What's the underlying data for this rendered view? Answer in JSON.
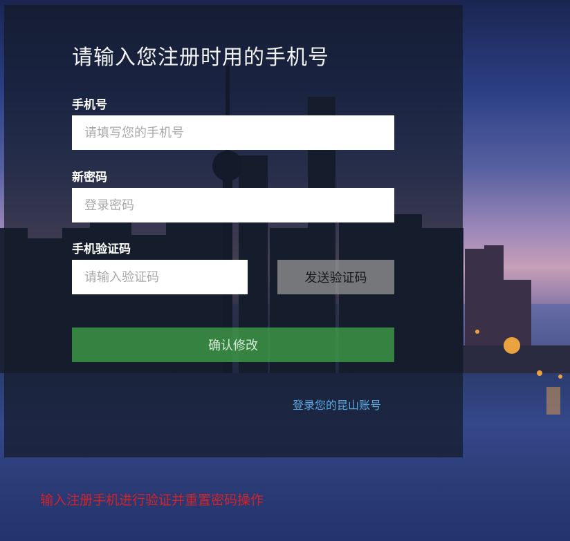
{
  "form": {
    "title": "请输入您注册时用的手机号",
    "phone": {
      "label": "手机号",
      "placeholder": "请填写您的手机号",
      "value": ""
    },
    "password": {
      "label": "新密码",
      "placeholder": "登录密码",
      "value": ""
    },
    "code": {
      "label": "手机验证码",
      "placeholder": "请输入验证码",
      "value": ""
    },
    "send_code_label": "发送验证码",
    "confirm_label": "确认修改",
    "login_link": "登录您的昆山账号"
  },
  "note": "输入注册手机进行验证并重置密码操作",
  "colors": {
    "panel_bg": "#141a28",
    "confirm_button": "#40a048",
    "send_button": "#969696",
    "link": "#5aa8e0",
    "note": "#d2232a"
  }
}
